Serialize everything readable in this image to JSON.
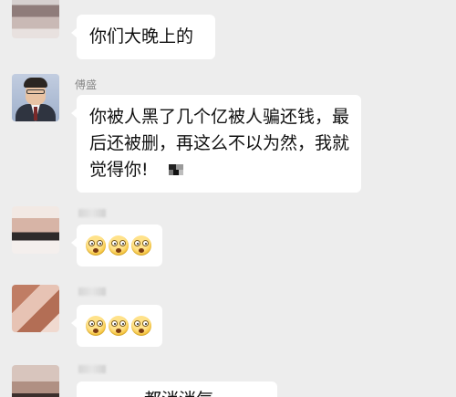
{
  "messages": [
    {
      "sender_visible": false,
      "text": "你们大晚上的"
    },
    {
      "sender": "傅盛",
      "lines": [
        "你被人黑了几个亿被人骗还钱，最",
        "后还被删，再这么不以为然，我就",
        "觉得你!"
      ]
    },
    {
      "sender_visible": false,
      "emojis": [
        "shocked-face-icon",
        "shocked-face-icon",
        "shocked-face-icon"
      ]
    },
    {
      "sender_visible": false,
      "emojis": [
        "shocked-face-icon",
        "shocked-face-icon",
        "shocked-face-icon"
      ]
    },
    {
      "sender_visible": false,
      "text": "都消消气"
    }
  ]
}
